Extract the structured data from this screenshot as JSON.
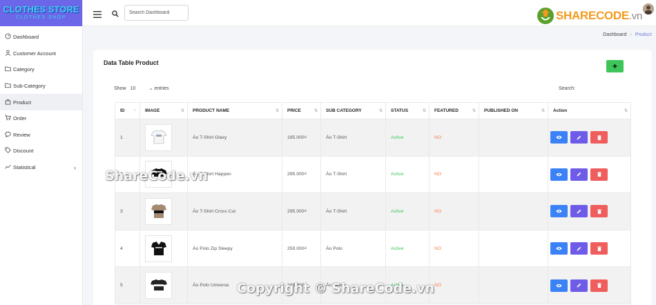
{
  "brand": {
    "line1": "CLOTHES STORE",
    "line2": "CLOTHES SHOP"
  },
  "sidebar": {
    "items": [
      {
        "label": "Dashboard",
        "icon": "gauge-icon"
      },
      {
        "label": "Customer Account",
        "icon": "user-icon"
      },
      {
        "label": "Category",
        "icon": "folder-icon"
      },
      {
        "label": "Sub-Category",
        "icon": "folder-icon"
      },
      {
        "label": "Product",
        "icon": "bag-icon",
        "active": true
      },
      {
        "label": "Order",
        "icon": "cart-icon"
      },
      {
        "label": "Review",
        "icon": "chat-icon"
      },
      {
        "label": "Discount",
        "icon": "tag-icon"
      },
      {
        "label": "Statistical",
        "icon": "chart-line-icon",
        "has_submenu": true
      }
    ]
  },
  "topbar": {
    "search_placeholder": "Search Dashboard"
  },
  "sharecode": {
    "brand": "SHARECODE",
    "tld": ".vn"
  },
  "breadcrumb": {
    "home": "Dashboard",
    "current": "Product"
  },
  "card": {
    "title": "Data Table Product",
    "add_label": "+"
  },
  "length": {
    "show": "Show",
    "value": "10",
    "entries": "entries"
  },
  "search_label": "Search:",
  "table": {
    "columns": [
      "ID",
      "IMAGE",
      "PRODUCT NAME",
      "PRICE",
      "SUB CATEGORY",
      "STATUS",
      "FEATURED",
      "PUBLISHED ON",
      "Action"
    ],
    "rows": [
      {
        "id": "1",
        "name": "Áo T-Shirt Glaxy",
        "price": "195.000₫",
        "sub": "Áo T-Shirt",
        "status": "Active",
        "featured": "NO",
        "published": "",
        "shirt": "white"
      },
      {
        "id": "2",
        "name": "Áo T-Shirt Happen",
        "price": "295.000₫",
        "sub": "Áo T-Shirt",
        "status": "Active",
        "featured": "NO",
        "published": "",
        "shirt": "black"
      },
      {
        "id": "3",
        "name": "Áo T-Shirt Cross Cut",
        "price": "295.000₫",
        "sub": "Áo T-Shirt",
        "status": "Active",
        "featured": "NO",
        "published": "",
        "shirt": "tan"
      },
      {
        "id": "4",
        "name": "Áo Polo Zip Sleepy",
        "price": "259.000₫",
        "sub": "Áo Polo",
        "status": "Active",
        "featured": "NO",
        "published": "",
        "shirt": "polo"
      },
      {
        "id": "5",
        "name": "Áo Polo Universe",
        "price": "249.000₫",
        "sub": "Áo Polo",
        "status": "Active",
        "featured": "NO",
        "published": "",
        "shirt": "stripe"
      }
    ]
  },
  "watermarks": {
    "center": "ShareCode.vn",
    "bottom": "Copyright © ShareCode.vn"
  },
  "colors": {
    "sidebar_logo_bg": "#6b67e8",
    "active": "#3ec55a",
    "no": "#f5854d",
    "view": "#3b82f6",
    "edit": "#6e5be8",
    "delete": "#f05d5d",
    "add": "#3ec55a"
  }
}
